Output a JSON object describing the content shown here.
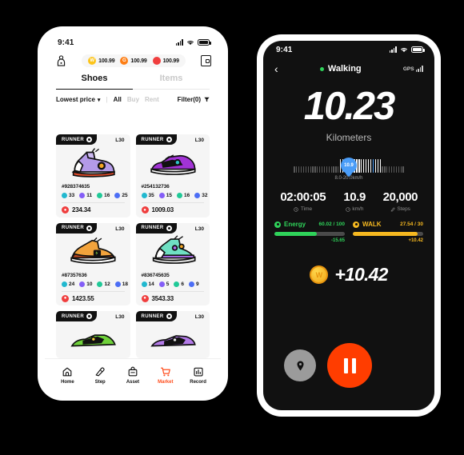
{
  "left_phone": {
    "status_bar": {
      "time": "9:41",
      "signal_icon": "signal-icon",
      "wifi_icon": "wifi-icon",
      "battery_icon": "battery-icon"
    },
    "topbar": {
      "profile_icon": "profile-icon",
      "wallet_icon": "wallet-icon",
      "coins": [
        {
          "symbol": "W",
          "value": "100.99",
          "color": "#fcc419"
        },
        {
          "symbol": "G",
          "value": "100.99",
          "color": "#fd7e14"
        },
        {
          "symbol": "",
          "value": "100.99",
          "color": "#f03e3e"
        }
      ]
    },
    "tabs": [
      {
        "label": "Shoes",
        "active": true
      },
      {
        "label": "Items",
        "active": false
      }
    ],
    "filterbar": {
      "sort_label": "Lowest price",
      "sort_chevron": "chevron-down-icon",
      "divider": "|",
      "options": [
        {
          "label": "All",
          "active": true
        },
        {
          "label": "Buy",
          "active": false
        },
        {
          "label": "Rent",
          "active": false
        }
      ],
      "filter_label": "Filter(0)",
      "filter_icon": "filter-icon"
    },
    "cards": [
      {
        "badge": "RUNNER",
        "level": "L30",
        "id": "#928374635",
        "stats": [
          {
            "value": "33"
          },
          {
            "value": "11"
          },
          {
            "value": "16"
          },
          {
            "value": "25"
          }
        ],
        "price": "234.34",
        "art": "sneaker-high-purple"
      },
      {
        "badge": "RUNNER",
        "level": "L30",
        "id": "#254132736",
        "stats": [
          {
            "value": "35"
          },
          {
            "value": "15"
          },
          {
            "value": "16"
          },
          {
            "value": "32"
          }
        ],
        "price": "1009.03",
        "art": "sneaker-low-purple"
      },
      {
        "badge": "RUNNER",
        "level": "L30",
        "id": "#87357636",
        "stats": [
          {
            "value": "24"
          },
          {
            "value": "10"
          },
          {
            "value": "12"
          },
          {
            "value": "18"
          }
        ],
        "price": "1423.55",
        "art": "sneaker-mid-orange"
      },
      {
        "badge": "RUNNER",
        "level": "L30",
        "id": "#836745635",
        "stats": [
          {
            "value": "14"
          },
          {
            "value": "5"
          },
          {
            "value": "6"
          },
          {
            "value": "9"
          }
        ],
        "price": "3543.33",
        "art": "sneaker-high-mint"
      },
      {
        "badge": "RUNNER",
        "level": "L30",
        "id": "",
        "stats": [],
        "price": "",
        "art": "sneaker-green"
      },
      {
        "badge": "RUNNER",
        "level": "L30",
        "id": "",
        "stats": [],
        "price": "",
        "art": "sneaker-violet"
      }
    ],
    "bottom_nav": [
      {
        "label": "Home",
        "icon": "home-icon",
        "active": false
      },
      {
        "label": "Step",
        "icon": "shoe-icon",
        "active": false
      },
      {
        "label": "Asset",
        "icon": "bag-icon",
        "active": false
      },
      {
        "label": "Market",
        "icon": "cart-icon",
        "active": true
      },
      {
        "label": "Record",
        "icon": "chart-icon",
        "active": false
      }
    ],
    "accent_color": "#ff4d1c"
  },
  "right_phone": {
    "status_bar": {
      "time": "9:41",
      "signal_icon": "signal-icon",
      "wifi_icon": "wifi-icon",
      "battery_icon": "battery-icon"
    },
    "header": {
      "back_icon": "back-chevron-icon",
      "title": "Walking",
      "live_dot_color": "#2fd35a",
      "gps_label": "GPS",
      "gps_icon": "signal-bars-icon"
    },
    "distance": {
      "value": "10.23",
      "unit": "Kilometers"
    },
    "speed_slider": {
      "pin_value": "10.9",
      "range_label": "8.0-20.0km/h",
      "pin_color": "#4a9df8"
    },
    "stats": [
      {
        "value": "02:00:05",
        "label": "Time",
        "icon": "clock-icon"
      },
      {
        "value": "10.9",
        "label": "km/h",
        "icon": "speed-icon"
      },
      {
        "value": "20,000",
        "label": "Steps",
        "icon": "shoe-icon"
      }
    ],
    "meters": [
      {
        "name": "Energy",
        "value": "60.02 / 100",
        "delta": "-15.65",
        "percent": 60,
        "color": "#2fd35a"
      },
      {
        "name": "WALK",
        "value": "27.54 / 30",
        "delta": "+10.42",
        "percent": 92,
        "color": "#f5b820"
      }
    ],
    "reward": {
      "coin_symbol": "W",
      "value": "+10.42"
    },
    "actions": {
      "location_icon": "location-pin-icon",
      "pause_icon": "pause-icon",
      "pause_color": "#ff3d00"
    }
  }
}
